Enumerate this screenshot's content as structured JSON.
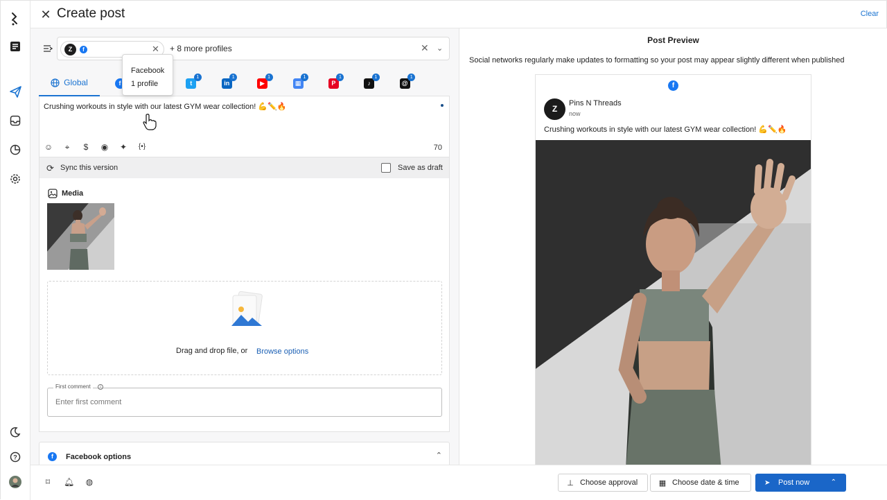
{
  "header": {
    "title": "Create post",
    "clear_label": "Clear"
  },
  "composer": {
    "profile_chip": {
      "avatar_letter": "Z",
      "network_letter": "f"
    },
    "more_profiles": "+ 8 more profiles",
    "tooltip": {
      "network": "Facebook",
      "count": "1 profile"
    },
    "tabs": {
      "global_label": "Global",
      "networks": [
        {
          "name": "facebook",
          "badge": "1",
          "color": "#1877f2",
          "glyph": "f"
        },
        {
          "name": "instagram",
          "badge": "1",
          "color": "#e1306c",
          "glyph": "◎"
        },
        {
          "name": "twitter",
          "badge": "1",
          "color": "#1da1f2",
          "glyph": "t"
        },
        {
          "name": "linkedin",
          "badge": "1",
          "color": "#0a66c2",
          "glyph": "in"
        },
        {
          "name": "youtube",
          "badge": "1",
          "color": "#ff0000",
          "glyph": "▶"
        },
        {
          "name": "google-business",
          "badge": "1",
          "color": "#4285f4",
          "glyph": "▦"
        },
        {
          "name": "pinterest",
          "badge": "1",
          "color": "#e60023",
          "glyph": "P"
        },
        {
          "name": "tiktok",
          "badge": "1",
          "color": "#111111",
          "glyph": "♪"
        },
        {
          "name": "threads",
          "badge": "1",
          "color": "#111111",
          "glyph": "@"
        }
      ]
    },
    "post_text": "Crushing workouts in style with our latest GYM wear collection! 💪✏️🔥",
    "char_count": "70",
    "tools": [
      "emoji-icon",
      "location-icon",
      "dollar-icon",
      "mention-icon",
      "handshake-icon",
      "variable-icon"
    ],
    "sync_label": "Sync this version",
    "draft_label": "Save as draft",
    "media_label": "Media",
    "drop_text": "Drag and drop file, or",
    "browse_label": "Browse options",
    "first_comment_label": "First comment",
    "first_comment_placeholder": "Enter first comment",
    "fb_options_label": "Facebook options"
  },
  "preview": {
    "title": "Post Preview",
    "note": "Social networks regularly make updates to formatting so your post may appear slightly different when published",
    "page_name": "Pins N Threads",
    "time": "now",
    "text": "Crushing workouts in style with our latest GYM wear collection! 💪✏️🔥"
  },
  "footer": {
    "approval_label": "Choose approval",
    "date_label": "Choose date & time",
    "post_label": "Post now"
  },
  "colors": {
    "accent": "#1a73d1",
    "primary_button": "#1a66c8",
    "facebook": "#1877f2"
  }
}
